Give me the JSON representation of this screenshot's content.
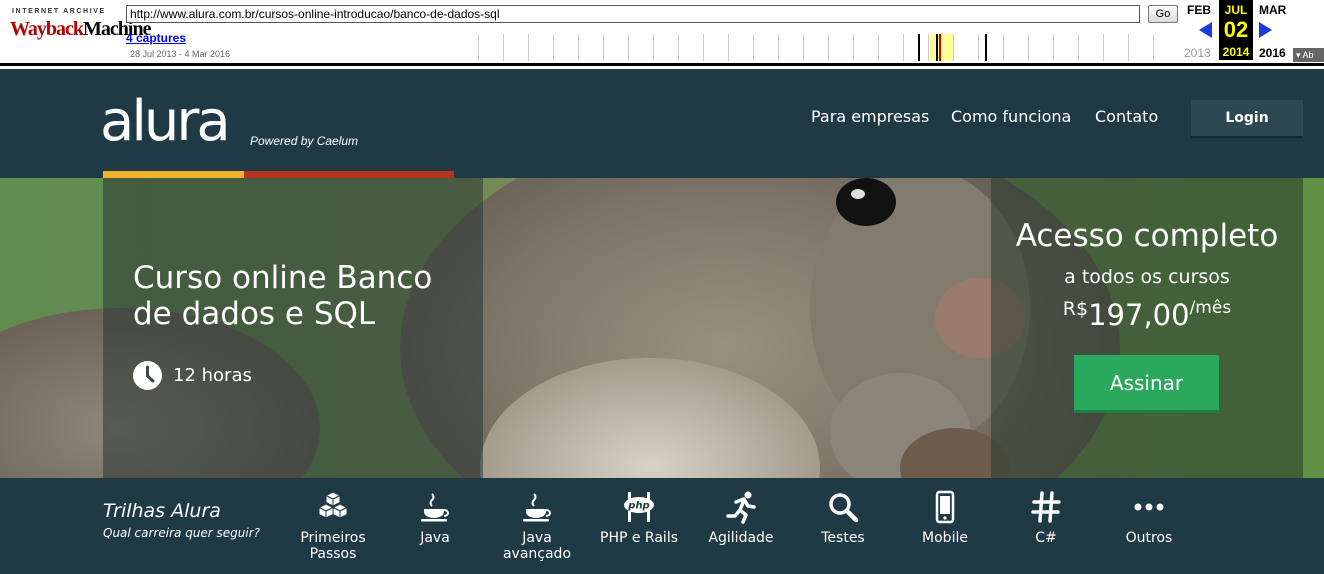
{
  "wayback": {
    "logo_top": "INTERNET ARCHIVE",
    "logo_way": "Wayback",
    "logo_machine": "Machine",
    "url": "http://www.alura.com.br/cursos-online-introducao/banco-de-dados-sql",
    "go_label": "Go",
    "captures": "4 captures",
    "range": "28 Jul 2013 - 4 Mar 2016",
    "prev_month": "FEB",
    "current_month": "JUL",
    "next_month": "MAR",
    "current_day": "02",
    "prev_year": "2013",
    "current_year": "2014",
    "next_year": "2016",
    "about": "Ab"
  },
  "header": {
    "logo": "alura",
    "powered": "Powered by Caelum",
    "nav": [
      "Para empresas",
      "Como funciona",
      "Contato"
    ],
    "login": "Login"
  },
  "hero": {
    "course_title": "Curso online Banco de dados e SQL",
    "duration": "12 horas",
    "promo_title": "Acesso completo",
    "promo_sub": "a todos os cursos",
    "price_currency": "R$",
    "price_amount": "197,00",
    "price_period": "/mês",
    "subscribe": "Assinar"
  },
  "tracks": {
    "title": "Trilhas Alura",
    "subtitle": "Qual carreira quer seguir?",
    "items": [
      {
        "label": "Primeiros Passos",
        "icon": "cubes-icon"
      },
      {
        "label": "Java",
        "icon": "coffee-cup-icon"
      },
      {
        "label": "Java avançado",
        "icon": "coffee-cup-icon"
      },
      {
        "label": "PHP e Rails",
        "icon": "php-icon"
      },
      {
        "label": "Agilidade",
        "icon": "running-person-icon"
      },
      {
        "label": "Testes",
        "icon": "magnifier-icon"
      },
      {
        "label": "Mobile",
        "icon": "mobile-phone-icon"
      },
      {
        "label": "C#",
        "icon": "hash-icon"
      },
      {
        "label": "Outros",
        "icon": "more-dots-icon"
      }
    ]
  },
  "colors": {
    "header_bg": "#1f3a44",
    "stripe_yellow": "#f0b22a",
    "stripe_red": "#b6341f",
    "subscribe_green": "#2aa85b",
    "wayback_link": "#0000ee"
  }
}
